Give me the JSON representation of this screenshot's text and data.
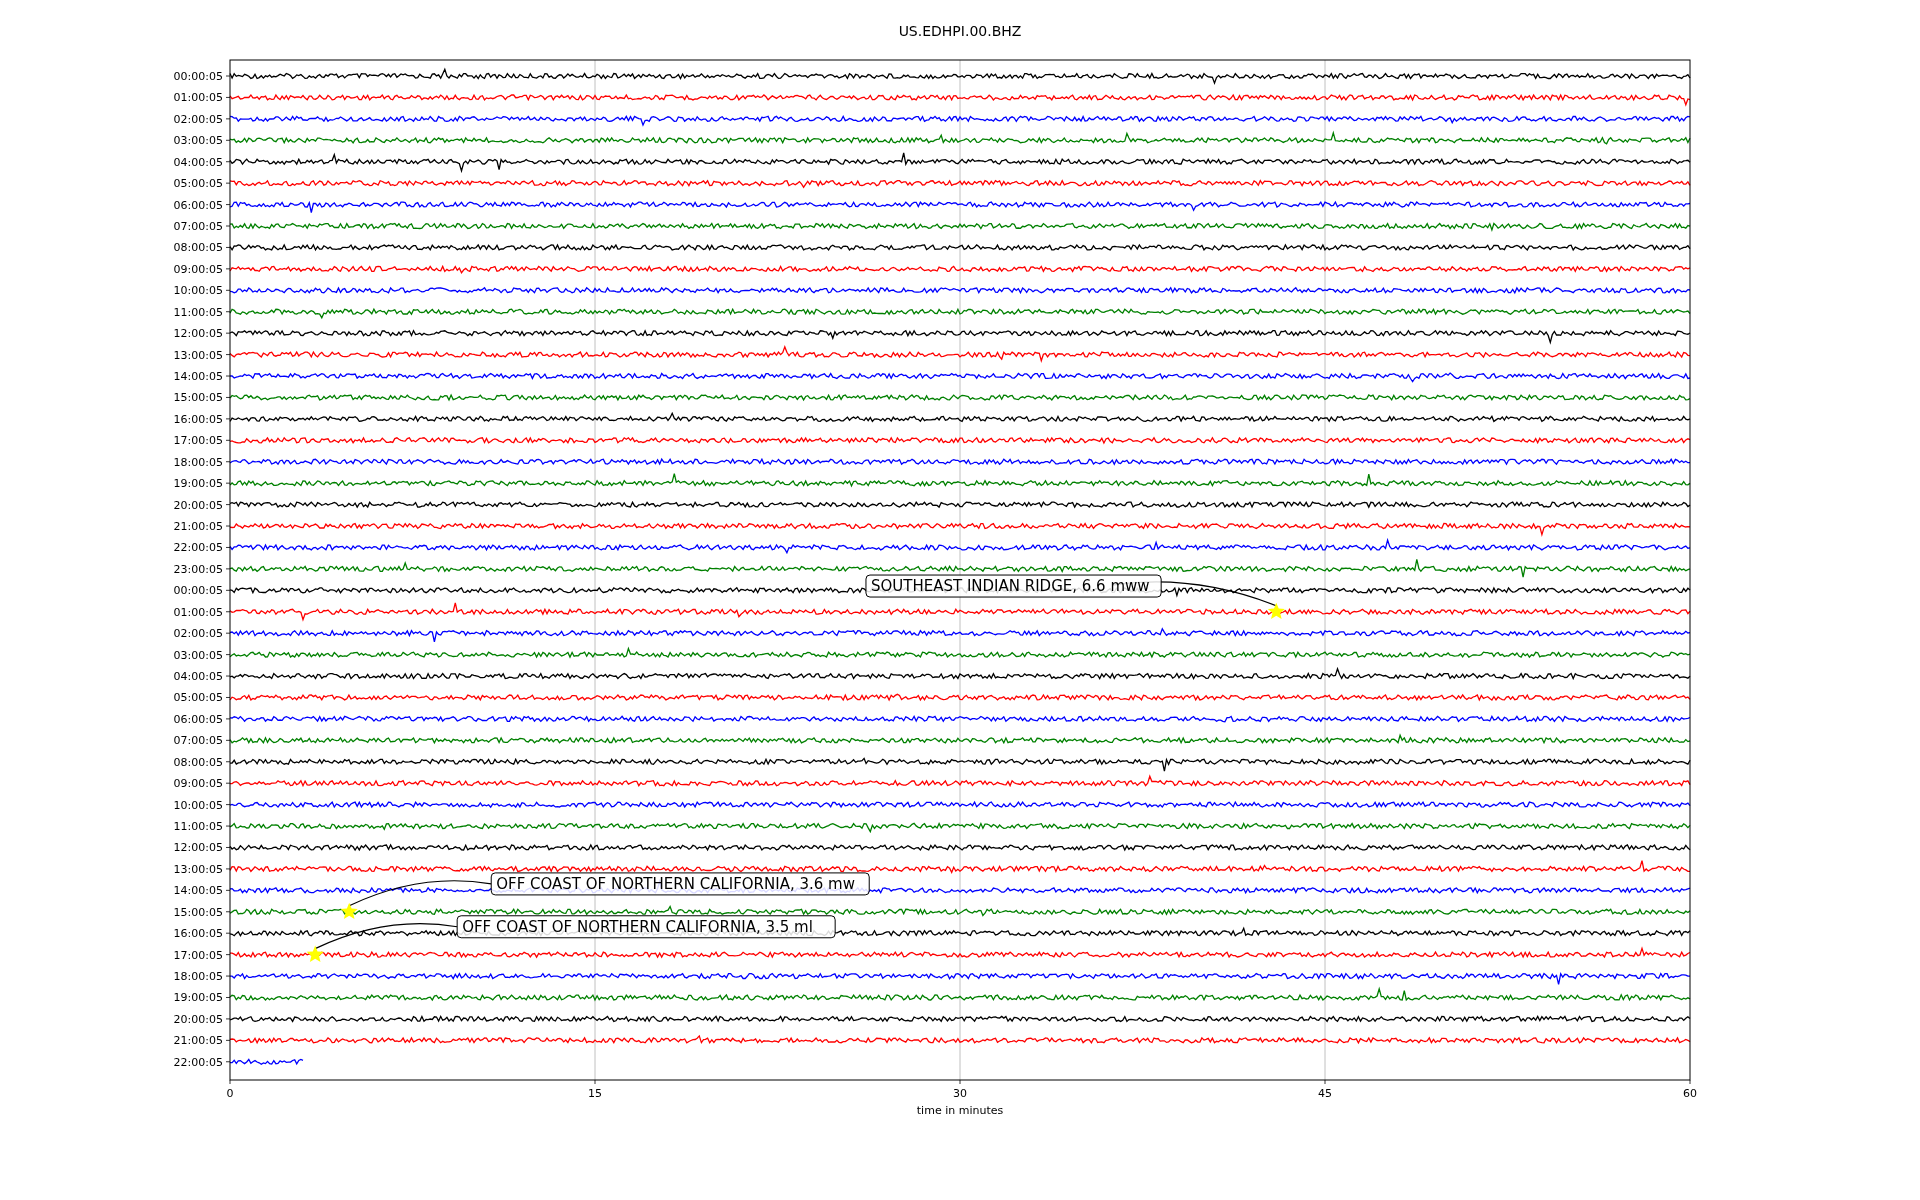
{
  "title": "US.EDHPI.00.BHZ",
  "xlabel": "time in minutes",
  "xticks": [
    "0",
    "15",
    "30",
    "45",
    "60"
  ],
  "rows": [
    {
      "label": "00:00:05",
      "color": "#000000"
    },
    {
      "label": "01:00:05",
      "color": "#ff0000"
    },
    {
      "label": "02:00:05",
      "color": "#0000ff"
    },
    {
      "label": "03:00:05",
      "color": "#008000"
    },
    {
      "label": "04:00:05",
      "color": "#000000"
    },
    {
      "label": "05:00:05",
      "color": "#ff0000"
    },
    {
      "label": "06:00:05",
      "color": "#0000ff"
    },
    {
      "label": "07:00:05",
      "color": "#008000"
    },
    {
      "label": "08:00:05",
      "color": "#000000"
    },
    {
      "label": "09:00:05",
      "color": "#ff0000"
    },
    {
      "label": "10:00:05",
      "color": "#0000ff"
    },
    {
      "label": "11:00:05",
      "color": "#008000"
    },
    {
      "label": "12:00:05",
      "color": "#000000"
    },
    {
      "label": "13:00:05",
      "color": "#ff0000"
    },
    {
      "label": "14:00:05",
      "color": "#0000ff"
    },
    {
      "label": "15:00:05",
      "color": "#008000"
    },
    {
      "label": "16:00:05",
      "color": "#000000"
    },
    {
      "label": "17:00:05",
      "color": "#ff0000"
    },
    {
      "label": "18:00:05",
      "color": "#0000ff"
    },
    {
      "label": "19:00:05",
      "color": "#008000"
    },
    {
      "label": "20:00:05",
      "color": "#000000"
    },
    {
      "label": "21:00:05",
      "color": "#ff0000"
    },
    {
      "label": "22:00:05",
      "color": "#0000ff"
    },
    {
      "label": "23:00:05",
      "color": "#008000"
    },
    {
      "label": "00:00:05",
      "color": "#000000"
    },
    {
      "label": "01:00:05",
      "color": "#ff0000"
    },
    {
      "label": "02:00:05",
      "color": "#0000ff"
    },
    {
      "label": "03:00:05",
      "color": "#008000"
    },
    {
      "label": "04:00:05",
      "color": "#000000"
    },
    {
      "label": "05:00:05",
      "color": "#ff0000"
    },
    {
      "label": "06:00:05",
      "color": "#0000ff"
    },
    {
      "label": "07:00:05",
      "color": "#008000"
    },
    {
      "label": "08:00:05",
      "color": "#000000"
    },
    {
      "label": "09:00:05",
      "color": "#ff0000"
    },
    {
      "label": "10:00:05",
      "color": "#0000ff"
    },
    {
      "label": "11:00:05",
      "color": "#008000"
    },
    {
      "label": "12:00:05",
      "color": "#000000"
    },
    {
      "label": "13:00:05",
      "color": "#ff0000"
    },
    {
      "label": "14:00:05",
      "color": "#0000ff"
    },
    {
      "label": "15:00:05",
      "color": "#008000"
    },
    {
      "label": "16:00:05",
      "color": "#000000"
    },
    {
      "label": "17:00:05",
      "color": "#ff0000"
    },
    {
      "label": "18:00:05",
      "color": "#0000ff"
    },
    {
      "label": "19:00:05",
      "color": "#008000"
    },
    {
      "label": "20:00:05",
      "color": "#000000"
    },
    {
      "label": "21:00:05",
      "color": "#ff0000"
    },
    {
      "label": "22:00:05",
      "color": "#0000ff"
    }
  ],
  "annotations": [
    {
      "text": "SOUTHEAST INDIAN RIDGE, 6.6 mww"
    },
    {
      "text": "OFF COAST OF NORTHERN CALIFORNIA, 3.6 mw"
    },
    {
      "text": "OFF COAST OF NORTHERN CALIFORNIA, 3.5 ml"
    }
  ]
}
